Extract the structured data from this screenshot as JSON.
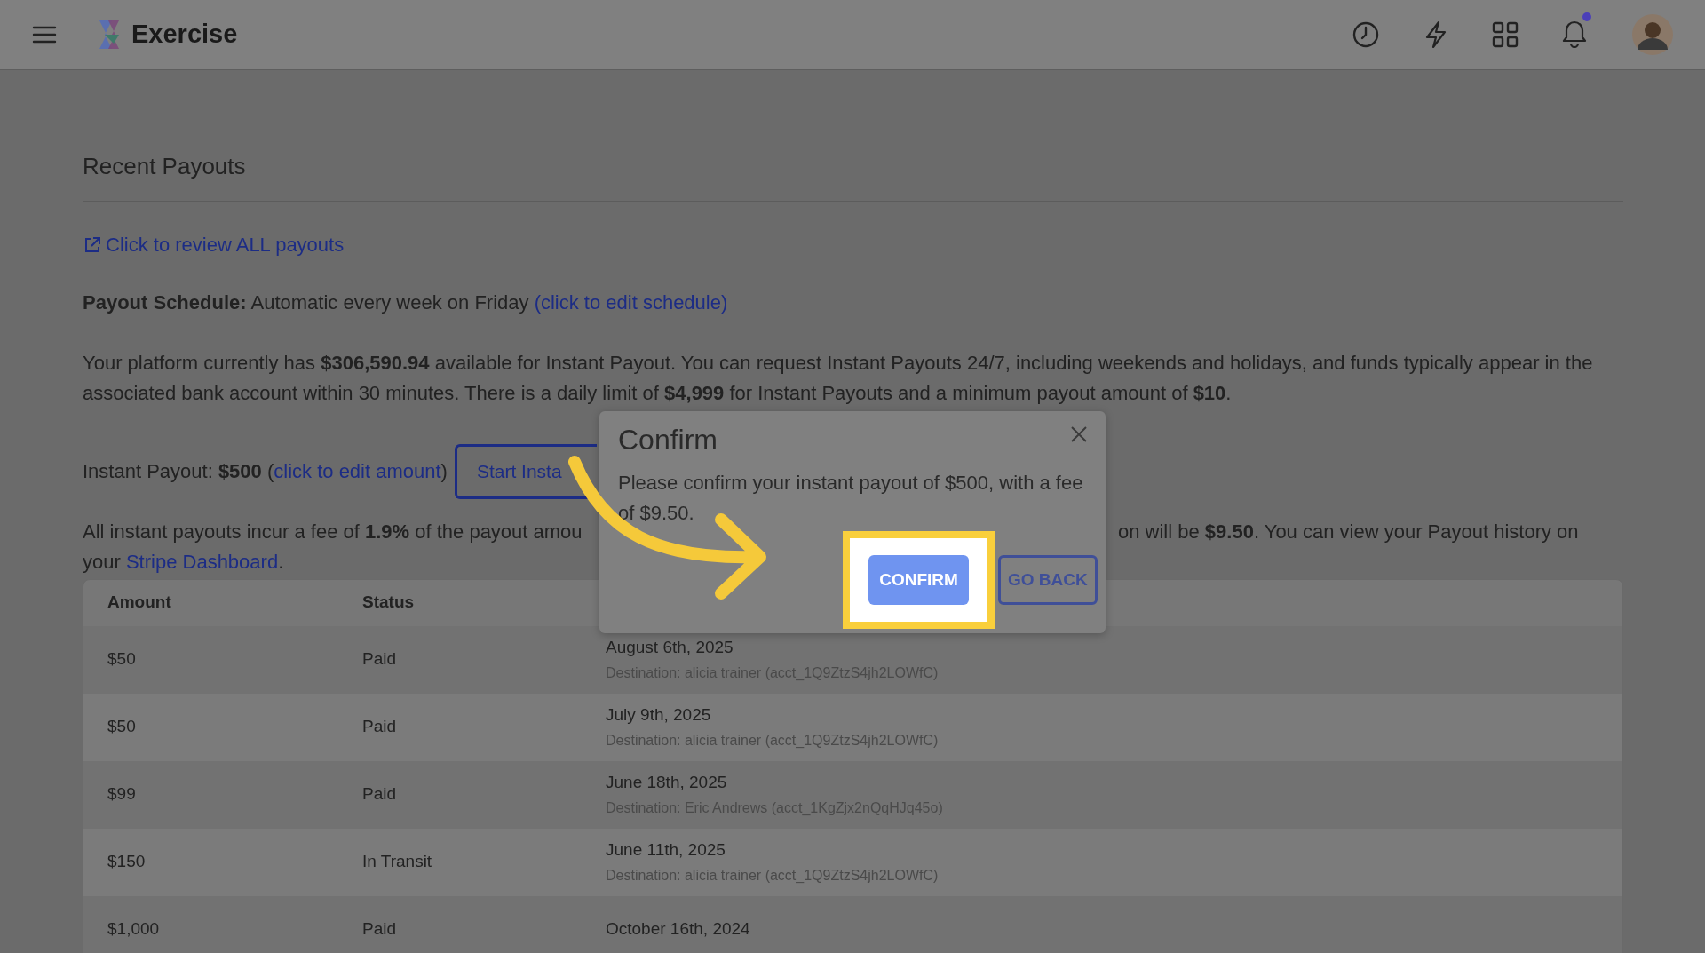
{
  "header": {
    "brand": "Exercise",
    "notifications": {
      "unread": true
    }
  },
  "section_title": "Recent Payouts",
  "review_link": "Click to review ALL payouts",
  "schedule": {
    "text": "**Payout Schedule:** Automatic every week on Friday",
    "link": "(click to edit schedule)"
  },
  "balance_text": "Your platform currently has **$306,590.94** available for Instant Payout. You can request Instant Payouts 24/7, including weekends and holidays, and funds typically appear in the associated bank account within 30 minutes. There is a daily limit of **$4,999** for Instant Payouts and a minimum payout amount of **$10**.",
  "instant_payout": {
    "text": "Instant Payout: **$500** (",
    "link": "click to edit amount",
    "after": ")",
    "button": "Start Insta"
  },
  "fee": {
    "left": "All instant payouts incur a fee of **1.9%** of the payout amou",
    "right": "on will be **$9.50**. You can view your Payout history on",
    "line2_before": "your",
    "link": "Stripe Dashboard",
    "line2_after": "."
  },
  "table": {
    "columns": [
      "Amount",
      "Status"
    ],
    "rows": [
      {
        "amount": "$50",
        "status": "Paid",
        "date": "August 6th, 2025",
        "destination": "Destination: alicia trainer (acct_1Q9ZtzS4jh2LOWfC)"
      },
      {
        "amount": "$50",
        "status": "Paid",
        "date": "July 9th, 2025",
        "destination": "Destination: alicia trainer (acct_1Q9ZtzS4jh2LOWfC)"
      },
      {
        "amount": "$99",
        "status": "Paid",
        "date": "June 18th, 2025",
        "destination": "Destination: Eric Andrews (acct_1KgZjx2nQqHJq45o)"
      },
      {
        "amount": "$150",
        "status": "In Transit",
        "date": "June 11th, 2025",
        "destination": "Destination: alicia trainer (acct_1Q9ZtzS4jh2LOWfC)"
      },
      {
        "amount": "$1,000",
        "status": "Paid",
        "date": "October 16th, 2024"
      }
    ]
  },
  "modal": {
    "title": "Confirm",
    "message": "Please confirm your instant payout of $500, with a fee of $9.50.",
    "buttons": [
      {
        "label": "CONFIRM",
        "kind": "primary",
        "highlighted": true
      },
      {
        "label": "GO BACK",
        "kind": "outline",
        "highlighted": false
      }
    ]
  }
}
